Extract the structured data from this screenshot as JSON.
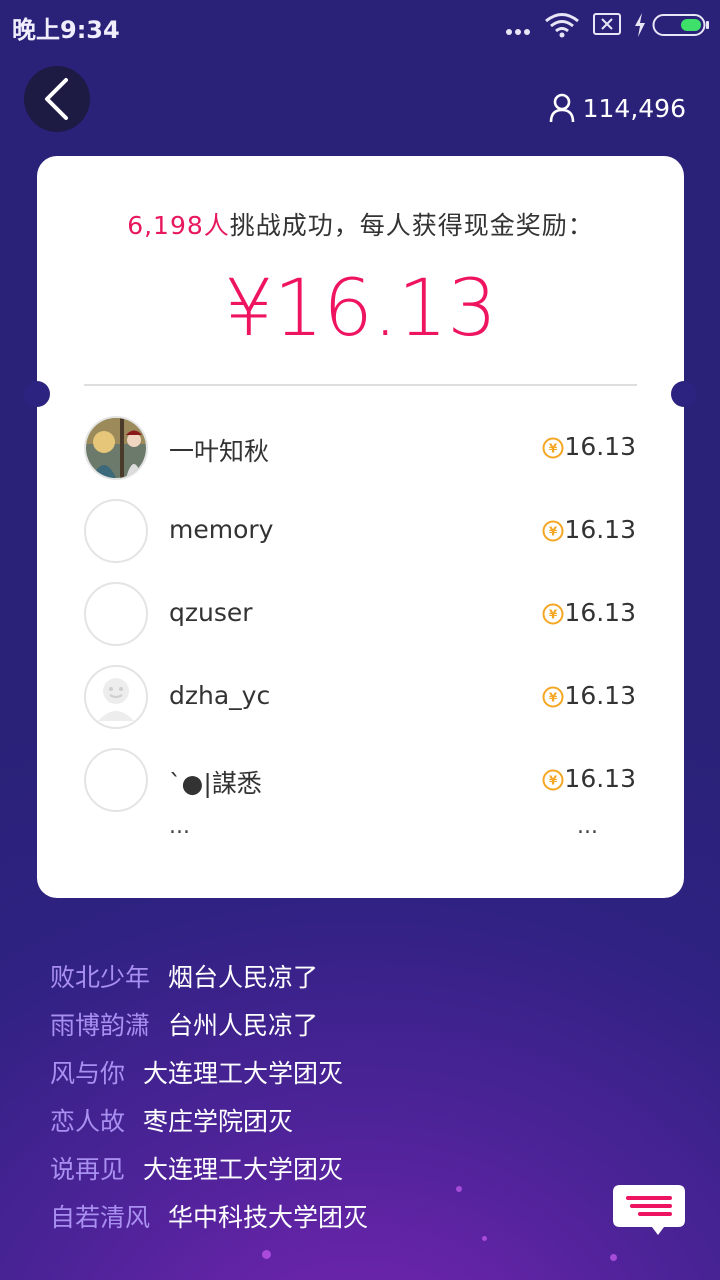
{
  "status_bar": {
    "time": "晚上9:34"
  },
  "header": {
    "online_count": "114,496"
  },
  "card": {
    "headline_count": "6,198人",
    "headline_text": "挑战成功，每人获得现金奖励：",
    "prize_amount": "¥16.13",
    "winners": [
      {
        "name": "一叶知秋",
        "amount": "16.13"
      },
      {
        "name": "memory",
        "amount": "16.13"
      },
      {
        "name": "qzuser",
        "amount": "16.13"
      },
      {
        "name": "dzha_yc",
        "amount": "16.13"
      },
      {
        "name": "`●|謀悉",
        "amount": "16.13"
      }
    ],
    "more_left": "...",
    "more_right": "..."
  },
  "feed": [
    {
      "user": "败北少年",
      "text": "烟台人民凉了"
    },
    {
      "user": "雨博韵潇",
      "text": "台州人民凉了"
    },
    {
      "user": "风与你",
      "text": "大连理工大学团灭"
    },
    {
      "user": "恋人故",
      "text": "枣庄学院团灭"
    },
    {
      "user": "说再见",
      "text": "大连理工大学团灭"
    },
    {
      "user": "自若清风",
      "text": "华中科技大学团灭"
    }
  ],
  "colors": {
    "accent": "#ee1460",
    "background": "#2c2280",
    "feed_user": "#a88ff0",
    "coin": "#f5a623"
  },
  "icons": [
    "back-arrow-icon",
    "user-icon",
    "coin-icon",
    "chat-icon",
    "wifi-icon",
    "battery-icon"
  ]
}
